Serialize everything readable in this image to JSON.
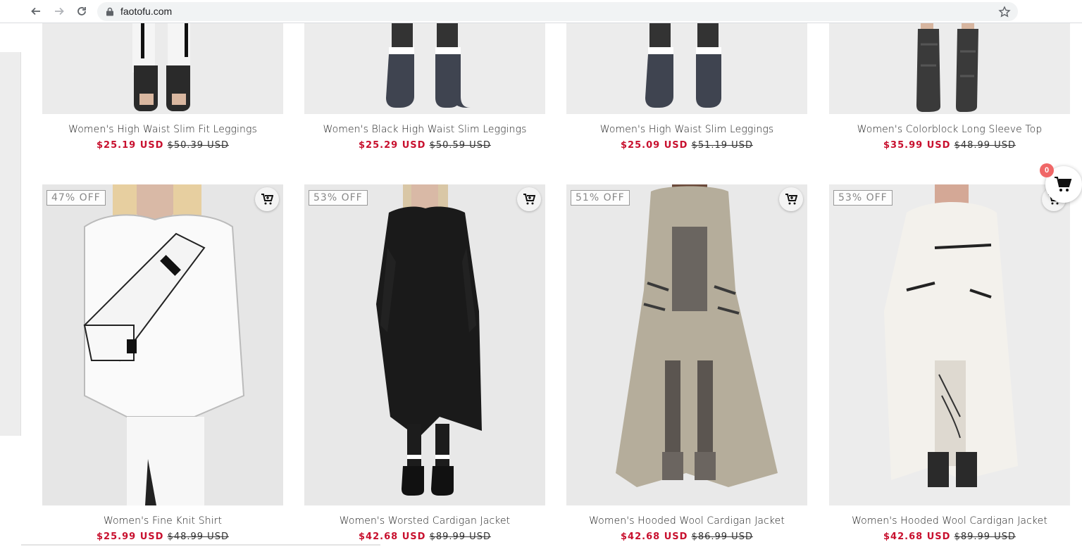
{
  "browser": {
    "url": "faotofu.com"
  },
  "floating_cart": {
    "count": "0"
  },
  "colors": {
    "sale": "#c8102e",
    "badge_border": "#999999",
    "cart_count_bg": "#f06767"
  },
  "row1": [
    {
      "name": "Women's High Waist Slim Fit Leggings",
      "sale_price": "$25.19 USD",
      "original_price": "$50.39 USD"
    },
    {
      "name": "Women's Black High Waist Slim Leggings",
      "sale_price": "$25.29 USD",
      "original_price": "$50.59 USD"
    },
    {
      "name": "Women's High Waist Slim Leggings",
      "sale_price": "$25.09 USD",
      "original_price": "$51.19 USD"
    },
    {
      "name": "Women's Colorblock Long Sleeve Top",
      "sale_price": "$35.99 USD",
      "original_price": "$48.99 USD"
    }
  ],
  "row2": [
    {
      "badge": "47% OFF",
      "name": "Women's Fine Knit Shirt",
      "sale_price": "$25.99 USD",
      "original_price": "$48.99 USD"
    },
    {
      "badge": "53% OFF",
      "name": "Women's Worsted Cardigan Jacket",
      "sale_price": "$42.68 USD",
      "original_price": "$89.99 USD"
    },
    {
      "badge": "51% OFF",
      "name": "Women's Hooded Wool Cardigan Jacket",
      "sale_price": "$42.68 USD",
      "original_price": "$86.99 USD"
    },
    {
      "badge": "53% OFF",
      "name": "Women's Hooded Wool Cardigan Jacket",
      "sale_price": "$42.68 USD",
      "original_price": "$89.99 USD"
    }
  ]
}
